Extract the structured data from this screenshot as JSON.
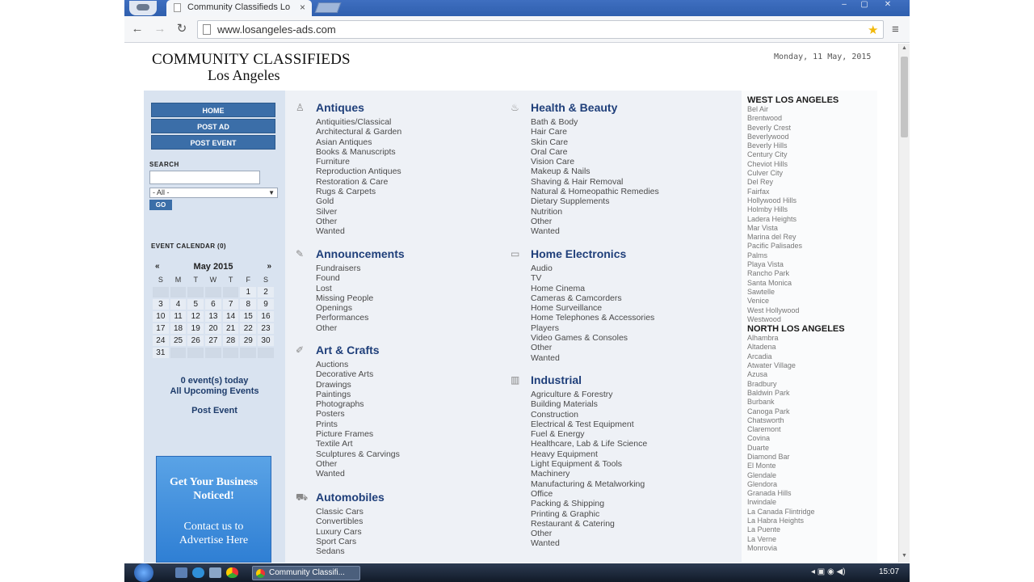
{
  "browser": {
    "tab_title": "Community Classifieds Lo",
    "url": "www.losangeles-ads.com"
  },
  "site": {
    "title": "COMMUNITY CLASSIFIEDS",
    "subtitle": "Los Angeles",
    "date": "Monday, 11 May, 2015"
  },
  "sidebar": {
    "nav": [
      "HOME",
      "POST AD",
      "POST EVENT"
    ],
    "search_label": "SEARCH",
    "search_select": "- All -",
    "go": "GO",
    "calendar_title": "EVENT CALENDAR (0)",
    "calendar": {
      "month": "May 2015",
      "prev": "«",
      "next": "»",
      "day_names": [
        "S",
        "M",
        "T",
        "W",
        "T",
        "F",
        "S"
      ],
      "days": [
        "",
        "",
        "",
        "",
        "",
        "1",
        "2",
        "3",
        "4",
        "5",
        "6",
        "7",
        "8",
        "9",
        "10",
        "11",
        "12",
        "13",
        "14",
        "15",
        "16",
        "17",
        "18",
        "19",
        "20",
        "21",
        "22",
        "23",
        "24",
        "25",
        "26",
        "27",
        "28",
        "29",
        "30",
        "31",
        "",
        "",
        "",
        "",
        "",
        ""
      ]
    },
    "events_today": "0 event(s) today",
    "upcoming": "All Upcoming Events",
    "post_event": "Post Event",
    "ad": [
      "Get Your Business",
      "Noticed!",
      "Contact us to",
      "Advertise Here"
    ]
  },
  "categories_left": [
    {
      "title": "Antiques",
      "icon": "trophy-icon",
      "items": [
        "Antiquities/Classical",
        "Architectural & Garden",
        "Asian Antiques",
        "Books & Manuscripts",
        "Furniture",
        "Reproduction Antiques",
        "Restoration & Care",
        "Rugs & Carpets",
        "Gold",
        "Silver",
        "Other",
        "Wanted"
      ]
    },
    {
      "title": "Announcements",
      "icon": "announcement-icon",
      "items": [
        "Fundraisers",
        "Found",
        "Lost",
        "Missing People",
        "Openings",
        "Performances",
        "Other"
      ]
    },
    {
      "title": "Art & Crafts",
      "icon": "brush-icon",
      "items": [
        "Auctions",
        "Decorative Arts",
        "Drawings",
        "Paintings",
        "Photographs",
        "Posters",
        "Prints",
        "Picture Frames",
        "Textile Art",
        "Sculptures & Carvings",
        "Other",
        "Wanted"
      ]
    },
    {
      "title": "Automobiles",
      "icon": "car-icon",
      "items": [
        "Classic Cars",
        "Convertibles",
        "Luxury Cars",
        "Sport Cars",
        "Sedans"
      ]
    }
  ],
  "categories_mid": [
    {
      "title": "Health & Beauty",
      "icon": "cosmetics-icon",
      "items": [
        "Bath & Body",
        "Hair Care",
        "Skin Care",
        "Oral Care",
        "Vision Care",
        "Makeup & Nails",
        "Shaving & Hair Removal",
        "Natural & Homeopathic Remedies",
        "Dietary Supplements",
        "Nutrition",
        "Other",
        "Wanted"
      ]
    },
    {
      "title": "Home Electronics",
      "icon": "monitor-icon",
      "items": [
        "Audio",
        "TV",
        "Home Cinema",
        "Cameras & Camcorders",
        "Home Surveillance",
        "Home Telephones & Accessories",
        "Players",
        "Video Games & Consoles",
        "Other",
        "Wanted"
      ]
    },
    {
      "title": "Industrial",
      "icon": "factory-icon",
      "items": [
        "Agriculture & Forestry",
        "Building Materials",
        "Construction",
        "Electrical & Test Equipment",
        "Fuel & Energy",
        "Healthcare, Lab & Life Science",
        "Heavy Equipment",
        "Light Equipment & Tools",
        "Machinery",
        "Manufacturing & Metalworking",
        "Office",
        "Packing & Shipping",
        "Printing & Graphic",
        "Restaurant & Catering",
        "Other",
        "Wanted"
      ]
    }
  ],
  "areas": [
    {
      "title": "WEST LOS ANGELES",
      "items": [
        "Bel Air",
        "Brentwood",
        "Beverly Crest",
        "Beverlywood",
        "Beverly Hills",
        "Century City",
        "Cheviot Hills",
        "Culver City",
        "Del Rey",
        "Fairfax",
        "Hollywood Hills",
        "Holmby Hills",
        "Ladera Heights",
        "Mar Vista",
        "Marina del Rey",
        "Pacific Palisades",
        "Palms",
        "Playa Vista",
        "Rancho Park",
        "Santa Monica",
        "Sawtelle",
        "Venice",
        "West Hollywood",
        "Westwood"
      ]
    },
    {
      "title": "NORTH LOS ANGELES",
      "items": [
        "Alhambra",
        "Altadena",
        "Arcadia",
        "Atwater Village",
        "Azusa",
        "Bradbury",
        "Baldwin Park",
        "Burbank",
        "Canoga Park",
        "Chatsworth",
        "Claremont",
        "Covina",
        "Duarte",
        "Diamond Bar",
        "El Monte",
        "Glendale",
        "Glendora",
        "Granada Hills",
        "Irwindale",
        "La Canada Flintridge",
        "La Habra Heights",
        "La Puente",
        "La Verne",
        "Monrovia"
      ]
    }
  ],
  "taskbar": {
    "task_label": "Community Classifi...",
    "clock": "15:07"
  }
}
